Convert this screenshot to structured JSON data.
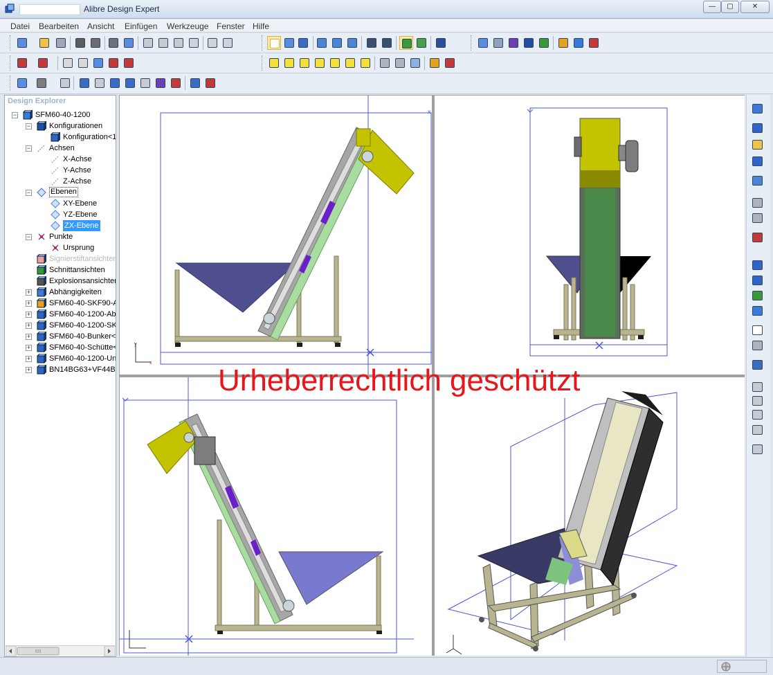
{
  "window": {
    "app_title": "Alibre Design Expert",
    "controls": {
      "minimize": "—",
      "maximize": "▢",
      "close": "✕"
    }
  },
  "menu": [
    "Datei",
    "Bearbeiten",
    "Ansicht",
    "Einfügen",
    "Werkzeuge",
    "Fenster",
    "Hilfe"
  ],
  "explorer": {
    "title": "Design Explorer",
    "tree": [
      {
        "label": "SFM60-40-1200",
        "icon": "assembly-icon",
        "expander": "−"
      },
      {
        "label": "Konfigurationen",
        "icon": "configurations-icon",
        "expander": "−"
      },
      {
        "label": "Konfiguration<1",
        "icon": "configuration-icon",
        "expander": ""
      },
      {
        "label": "Achsen",
        "icon": "axes-icon",
        "expander": "−"
      },
      {
        "label": "X-Achse",
        "icon": "axis-icon",
        "expander": ""
      },
      {
        "label": "Y-Achse",
        "icon": "axis-icon",
        "expander": ""
      },
      {
        "label": "Z-Achse",
        "icon": "axis-icon",
        "expander": ""
      },
      {
        "label": "Ebenen",
        "icon": "planes-icon",
        "expander": "−"
      },
      {
        "label": "XY-Ebene",
        "icon": "plane-icon",
        "expander": ""
      },
      {
        "label": "YZ-Ebene",
        "icon": "plane-icon",
        "expander": ""
      },
      {
        "label": "ZX-Ebene",
        "icon": "plane-icon",
        "expander": ""
      },
      {
        "label": "Punkte",
        "icon": "points-icon",
        "expander": "−"
      },
      {
        "label": "Ursprung",
        "icon": "origin-icon",
        "expander": ""
      },
      {
        "label": "Signierstiftansichten",
        "icon": "redline-icon",
        "expander": ""
      },
      {
        "label": "Schnittansichten",
        "icon": "section-view-icon",
        "expander": ""
      },
      {
        "label": "Explosionsansichten",
        "icon": "exploded-view-icon",
        "expander": ""
      },
      {
        "label": "Abhängigkeiten",
        "icon": "constraints-icon",
        "expander": "+"
      },
      {
        "label": "SFM60-40-SKF90-A",
        "icon": "subassembly-icon",
        "expander": "+"
      },
      {
        "label": "SFM60-40-1200-Abc",
        "icon": "part-icon",
        "expander": "+"
      },
      {
        "label": "SFM60-40-1200-SK",
        "icon": "part-icon",
        "expander": "+"
      },
      {
        "label": "SFM60-40-Bunker<",
        "icon": "part-icon",
        "expander": "+"
      },
      {
        "label": "SFM60-40-Schütte<",
        "icon": "part-icon",
        "expander": "+"
      },
      {
        "label": "SFM60-40-1200-Unt",
        "icon": "part-icon",
        "expander": "+"
      },
      {
        "label": "BN14BG63+VF44B0",
        "icon": "part-icon",
        "expander": "+"
      }
    ]
  },
  "viewports": {
    "watermark": "Urheberrechtlich geschützt"
  },
  "colors": {
    "frame": "#b7b48f",
    "hopper": "#4f4f8f",
    "hopper_light": "#7979cf",
    "chute": "#c3c300",
    "belt": "#a6a6a6",
    "belt_inner": "#dedede",
    "green": "#a9dca0",
    "purple": "#6a1fc8",
    "plane_lines": "#4b55d6",
    "watermark": "#e8151b"
  }
}
